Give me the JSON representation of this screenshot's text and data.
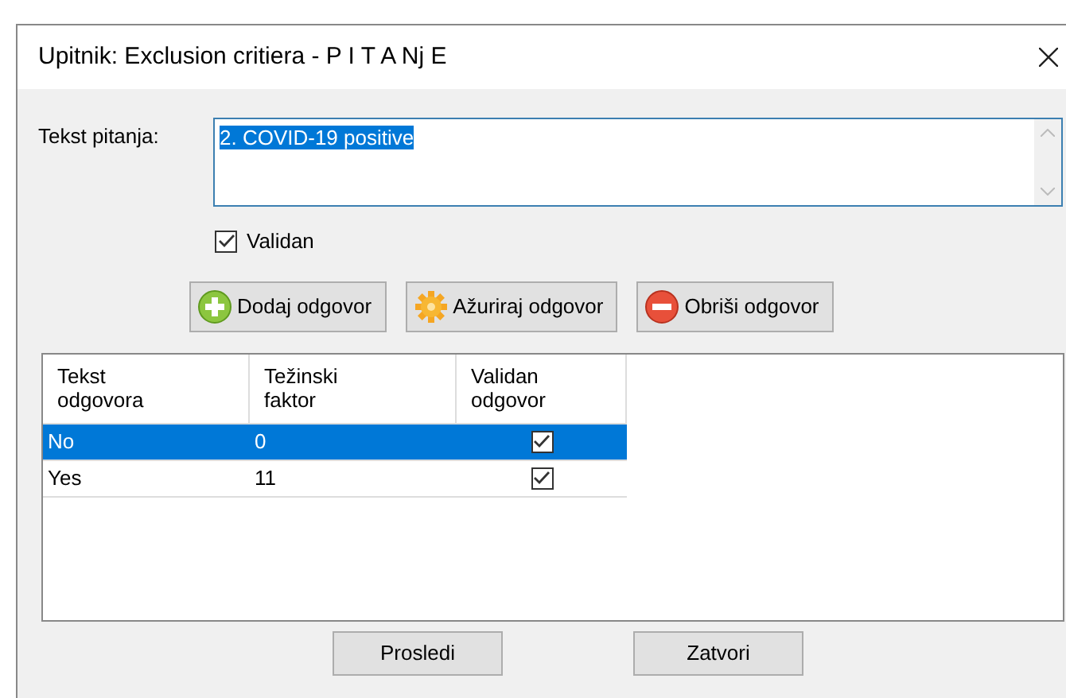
{
  "window": {
    "title": "Upitnik: Exclusion critiera - P I T A Nj E"
  },
  "question": {
    "label": "Tekst pitanja:",
    "value": "2. COVID-19 positive",
    "selected": true
  },
  "valid_checkbox": {
    "label": "Validan",
    "checked": true
  },
  "action_buttons": [
    {
      "kind": "add",
      "label": "Dodaj odgovor"
    },
    {
      "kind": "update",
      "label": "Ažuriraj odgovor"
    },
    {
      "kind": "delete",
      "label": "Obriši odgovor"
    }
  ],
  "table": {
    "columns": [
      {
        "line1": "Tekst",
        "line2": "odgovora"
      },
      {
        "line1": "Težinski",
        "line2": "faktor"
      },
      {
        "line1": "Validan",
        "line2": "odgovor"
      }
    ],
    "rows": [
      {
        "answer": "No",
        "weight": "0",
        "valid": true,
        "selected": true
      },
      {
        "answer": "Yes",
        "weight": "11",
        "valid": true,
        "selected": false
      }
    ]
  },
  "footer_buttons": [
    "Prosledi",
    "Zatvori"
  ]
}
